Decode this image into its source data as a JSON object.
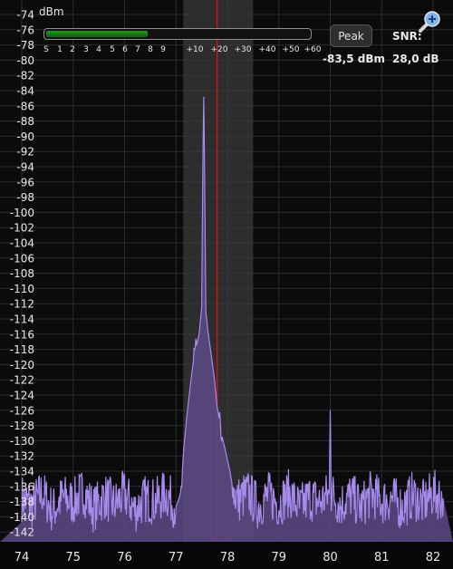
{
  "colors": {
    "background": "#0b0b0b",
    "grid": "#2c2c2c",
    "passband": "#3a3a3a",
    "trace": "#a68aec",
    "fill": "#5d4a86",
    "center_line": "#e01010",
    "text": "#e8e8e8",
    "meter_green": "#1a8a1a"
  },
  "smeter": {
    "unit_label": "dBm",
    "level": 0.38,
    "scale": [
      "S",
      "1",
      "2",
      "3",
      "4",
      "5",
      "6",
      "7",
      "8",
      "9",
      "+10",
      "+20",
      "+30",
      "+40",
      "+50",
      "+60"
    ]
  },
  "controls": {
    "peak_label": "Peak",
    "snr_label": "SNR:",
    "peak_value": "-83,5 dBm",
    "snr_value": "28,0 dB",
    "zoom_icon": "zoom-in-icon"
  },
  "chart_data": {
    "type": "line",
    "ylabel": "dBm",
    "ylim": [
      -143,
      -74
    ],
    "xlim": [
      74,
      82.2
    ],
    "y_ticks": [
      -74,
      -76,
      -78,
      -80,
      -82,
      -84,
      -86,
      -88,
      -90,
      -92,
      -94,
      -96,
      -98,
      -100,
      -102,
      -104,
      -106,
      -108,
      -110,
      -112,
      -114,
      -116,
      -118,
      -120,
      -122,
      -124,
      -126,
      -128,
      -130,
      -132,
      -134,
      -136,
      -138,
      -140,
      -142
    ],
    "x_ticks": [
      74,
      75,
      76,
      77,
      78,
      79,
      80,
      81,
      82
    ],
    "passband": [
      77.14,
      78.5
    ],
    "center_frequency": 77.8,
    "series": [
      {
        "values": [
          [
            74.0,
            -137.5
          ],
          [
            74.2,
            -138.5
          ],
          [
            74.4,
            -136.8
          ],
          [
            74.6,
            -139.2
          ],
          [
            74.8,
            -137.4
          ],
          [
            75.0,
            -138.1
          ],
          [
            75.2,
            -136.6
          ],
          [
            75.4,
            -139.0
          ],
          [
            75.6,
            -137.2
          ],
          [
            75.8,
            -138.4
          ],
          [
            76.0,
            -137.0
          ],
          [
            76.2,
            -139.1
          ],
          [
            76.4,
            -137.6
          ],
          [
            76.6,
            -138.0
          ],
          [
            76.8,
            -136.9
          ],
          [
            77.0,
            -138.6
          ],
          [
            77.05,
            -137.8
          ],
          [
            77.1,
            -136.5
          ],
          [
            77.15,
            -131.0
          ],
          [
            77.2,
            -127.5
          ],
          [
            77.25,
            -124.5
          ],
          [
            77.3,
            -121.5
          ],
          [
            77.35,
            -119.0
          ],
          [
            77.4,
            -117.5
          ],
          [
            77.45,
            -116.0
          ],
          [
            77.5,
            -112.5
          ],
          [
            77.52,
            -95.0
          ],
          [
            77.54,
            -84.8
          ],
          [
            77.56,
            -97.0
          ],
          [
            77.58,
            -113.0
          ],
          [
            77.62,
            -115.5
          ],
          [
            77.66,
            -117.5
          ],
          [
            77.7,
            -119.5
          ],
          [
            77.75,
            -122.0
          ],
          [
            77.8,
            -125.5
          ],
          [
            77.85,
            -127.5
          ],
          [
            77.9,
            -129.5
          ],
          [
            77.95,
            -131.0
          ],
          [
            78.0,
            -132.5
          ],
          [
            78.05,
            -134.0
          ],
          [
            78.1,
            -136.2
          ],
          [
            78.2,
            -137.8
          ],
          [
            78.4,
            -136.9
          ],
          [
            78.6,
            -138.6
          ],
          [
            78.8,
            -137.1
          ],
          [
            79.0,
            -138.3
          ],
          [
            79.2,
            -136.8
          ],
          [
            79.4,
            -138.9
          ],
          [
            79.6,
            -137.4
          ],
          [
            79.8,
            -138.1
          ],
          [
            79.98,
            -137.0
          ],
          [
            80.0,
            -126.0
          ],
          [
            80.02,
            -136.8
          ],
          [
            80.2,
            -138.4
          ],
          [
            80.4,
            -137.2
          ],
          [
            80.6,
            -138.7
          ],
          [
            80.8,
            -136.9
          ],
          [
            81.0,
            -138.0
          ],
          [
            81.2,
            -137.5
          ],
          [
            81.4,
            -138.8
          ],
          [
            81.6,
            -137.1
          ],
          [
            81.8,
            -138.3
          ],
          [
            82.0,
            -136.9
          ],
          [
            82.2,
            -137.6
          ]
        ]
      }
    ]
  }
}
